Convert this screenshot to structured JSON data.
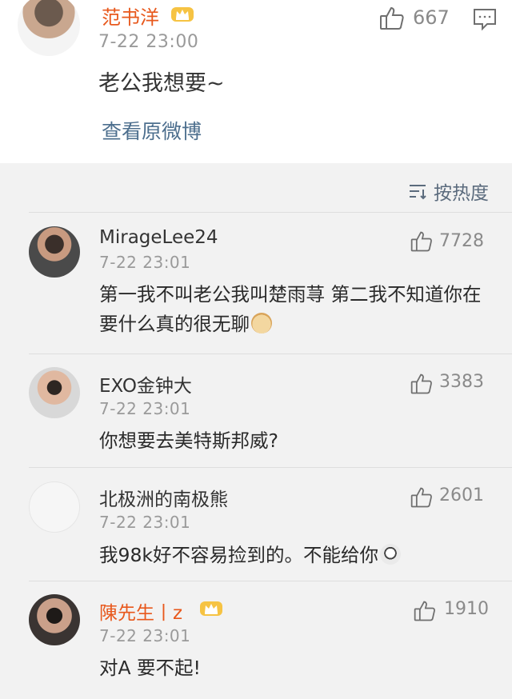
{
  "post": {
    "author": "范书洋",
    "time": "7-22 23:00",
    "likes": "667",
    "content": "老公我想要~",
    "view_original": "查看原微博"
  },
  "sort": {
    "label": "按热度"
  },
  "comments": [
    {
      "author": "MirageLee24",
      "time": "7-22 23:01",
      "likes": "7728",
      "text": "第一我不叫老公我叫楚雨荨 第二我不知道你在要什么真的很无聊"
    },
    {
      "author": "EXO金钟大",
      "time": "7-22 23:01",
      "likes": "3383",
      "text": "你想要去美特斯邦威?"
    },
    {
      "author": "北极洲的南极熊",
      "time": "7-22 23:01",
      "likes": "2601",
      "text": "我98k好不容易捡到的。不能给你"
    },
    {
      "author": "陳先生丨z",
      "time": "7-22 23:01",
      "likes": "1910",
      "text": "对A  要不起!"
    }
  ],
  "colors": {
    "vip_name": "#e8581c",
    "link": "#4d6f8e",
    "meta": "#9a9a9a",
    "page_bg": "#f2f2f2"
  },
  "icons": {
    "like": "thumbs-up-icon",
    "comment": "comment-icon",
    "sort": "sort-icon",
    "crown": "crown-icon"
  }
}
